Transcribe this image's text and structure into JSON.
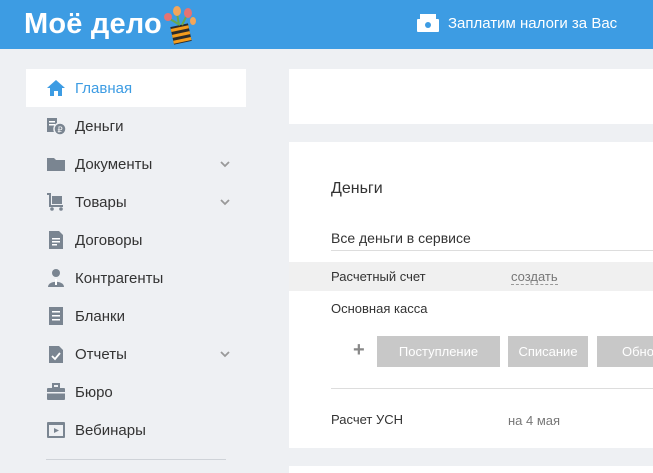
{
  "header": {
    "logo_text": "Моё дело",
    "tax_link_label": "Заплатим налоги за Вас",
    "color": "#3d9ce3"
  },
  "sidebar": {
    "items": [
      {
        "label": "Главная",
        "icon": "home-icon",
        "active": true
      },
      {
        "label": "Деньги",
        "icon": "money-icon"
      },
      {
        "label": "Документы",
        "icon": "folder-icon",
        "expandable": true
      },
      {
        "label": "Товары",
        "icon": "cart-icon",
        "expandable": true
      },
      {
        "label": "Договоры",
        "icon": "contract-icon"
      },
      {
        "label": "Контрагенты",
        "icon": "person-icon"
      },
      {
        "label": "Бланки",
        "icon": "blank-form-icon"
      },
      {
        "label": "Отчеты",
        "icon": "report-icon",
        "expandable": true
      },
      {
        "label": "Бюро",
        "icon": "briefcase-icon"
      },
      {
        "label": "Вебинары",
        "icon": "webinar-icon"
      }
    ]
  },
  "money_card": {
    "title": "Деньги",
    "all_money_label": "Все деньги в сервисе",
    "bank_account_label": "Расчетный счет",
    "create_link": "создать",
    "cash_label": "Основная касса",
    "income_button": "Поступление",
    "writeoff_button": "Списание",
    "third_button": "Обно",
    "usn_label": "Расчет УСН",
    "usn_date": "на 4 мая"
  }
}
